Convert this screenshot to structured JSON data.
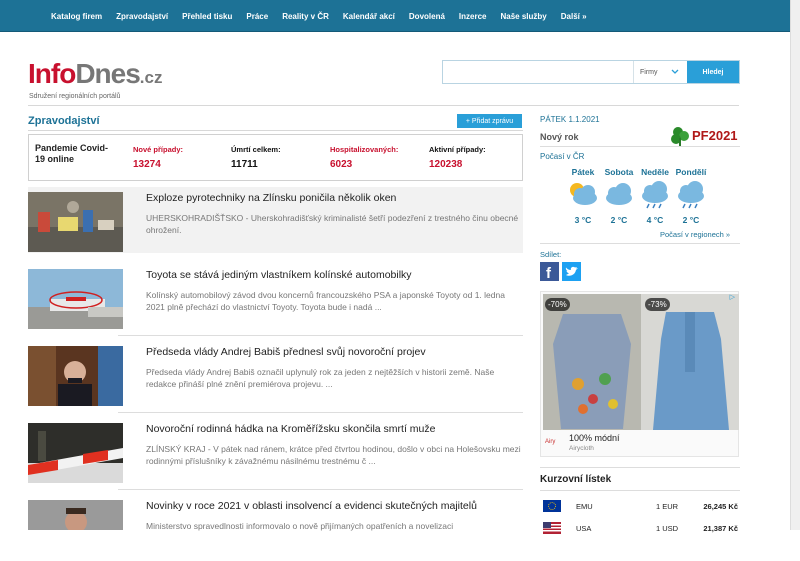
{
  "nav": [
    "Katalog firem",
    "Zpravodajství",
    "Přehled tisku",
    "Práce",
    "Reality v ČR",
    "Kalendář akcí",
    "Dovolená",
    "Inzerce",
    "Naše služby",
    "Další »"
  ],
  "logo": {
    "part1": "Info",
    "part2": "Dnes",
    "part3": ".cz",
    "tagline": "Sdružení regionálních portálů"
  },
  "search": {
    "placeholder": "",
    "select": "Firmy",
    "button": "Hledej"
  },
  "news": {
    "title": "Zpravodajství",
    "add_button": "+ Přidat zprávu",
    "covid": {
      "label": "Pandemie Covid-19 online",
      "stats": [
        {
          "label": "Nové případy:",
          "value": "13274"
        },
        {
          "label": "Úmrtí celkem:",
          "value": "11711"
        },
        {
          "label": "Hospitalizovaných:",
          "value": "6023"
        },
        {
          "label": "Aktivní případy:",
          "value": "120238"
        }
      ]
    },
    "articles": [
      {
        "title": "Exploze pyrotechniky na Zlínsku poničila několik oken",
        "desc": "UHERSKOHRADIŠŤSKO - Uherskohradišťský kriminalisté šetří podezření z trestného činu obecné ohrožení."
      },
      {
        "title": "Toyota se stává jediným vlastníkem kolínské automobilky",
        "desc": "Kolínský automobilový závod dvou koncernů francouzského PSA a japonské Toyoty od 1. ledna 2021 plně přechází do vlastnictví Toyoty. Toyota bude i nadá ..."
      },
      {
        "title": "Předseda vlády Andrej Babiš přednesl svůj novoroční projev",
        "desc": "Předseda vlády Andrej Babiš označil uplynulý rok za jeden z nejtěžších v historii země. Naše redakce přináší plné znění premiérova projevu. ..."
      },
      {
        "title": "Novoroční rodinná hádka na Kroměřížsku skončila smrtí muže",
        "desc": "ZLÍNSKÝ KRAJ - V pátek nad ránem, krátce před čtvrtou hodinou, došlo v obci na Holešovsku mezi rodinnými příslušníky k závažnému násilnému trestnému č ..."
      },
      {
        "title": "Novinky v roce 2021 v oblasti insolvencí a evidenci skutečných majitelů",
        "desc": "Ministerstvo spravedlnosti informovalo o nově přijímaných opatřeních a novelizaci"
      }
    ]
  },
  "sidebar": {
    "date": "PÁTEK 1.1.2021",
    "nameday": "Nový rok",
    "pf_text": "PF2021",
    "weather_title": "Počasí v ČR",
    "days": [
      {
        "name": "Pátek",
        "temp": "3 °C"
      },
      {
        "name": "Sobota",
        "temp": "2 °C"
      },
      {
        "name": "Neděle",
        "temp": "4 °C"
      },
      {
        "name": "Pondělí",
        "temp": "2 °C"
      }
    ],
    "weather_link": "Počasí v regionech »",
    "share": "Sdílet:",
    "ad": {
      "disc1": "-70%",
      "disc2": "-73%",
      "brand": "Airy",
      "text": "100% módní",
      "sub": "Airycloth"
    },
    "currency_title": "Kurzovní lístek",
    "currency": [
      {
        "code": "EMU",
        "amount": "1 EUR",
        "rate": "26,245 Kč"
      },
      {
        "code": "USA",
        "amount": "1 USD",
        "rate": "21,387 Kč"
      }
    ]
  },
  "colors": {
    "brand": "#1d7296",
    "accent": "#2a9fd8",
    "red": "#c8102e"
  }
}
